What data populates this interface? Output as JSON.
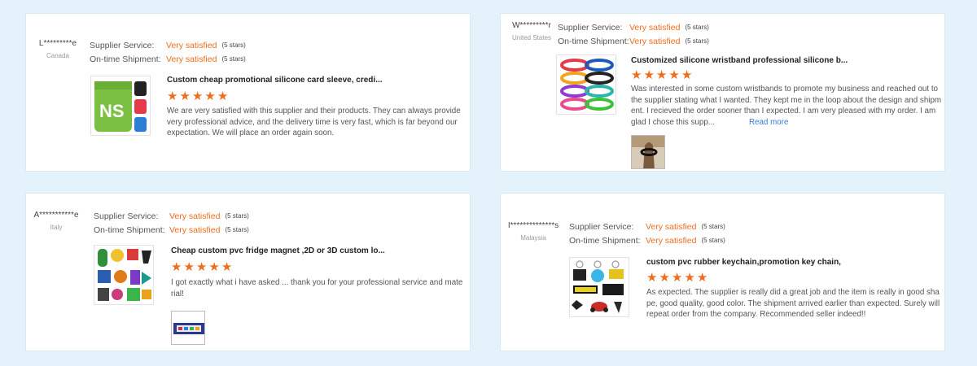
{
  "reviews": [
    {
      "buyer": "L*********e",
      "country": "Canada",
      "supplier_label": "Supplier Service:",
      "supplier_value": "Very satisfied",
      "supplier_stars": "(5 stars)",
      "shipment_label": "On-time Shipment:",
      "shipment_value": "Very satisfied",
      "shipment_stars": "(5 stars)",
      "product_title": "Custom cheap promotional silicone card sleeve, credi...",
      "rating": 5,
      "text": "We are very satisfied with this supplier and their products. They can always provide very professional advice, and the delivery time is very fast, which is far beyond our expectation. We will place an order again soon.",
      "image_icon": "silicone-card-sleeve-product-icon"
    },
    {
      "buyer": "W*********r",
      "country": "United States",
      "supplier_label": "Supplier Service:",
      "supplier_value": "Very satisfied",
      "supplier_stars": "(5 stars)",
      "shipment_label": "On-time Shipment:",
      "shipment_value": "Very satisfied",
      "shipment_stars": "(5 stars)",
      "product_title": "Customized silicone wristband professional silicone b...",
      "rating": 5,
      "text": "Was interested in some custom wristbands to promote my business and reached out to the supplier stating what I wanted. They kept me in the loop about the design and shipment. I recieved the order sooner than I expected. I am very pleased with my order. I am glad I chose this supp...",
      "read_more": "Read more",
      "image_icon": "silicone-wristband-product-icon",
      "buyer_photo_icon": "buyer-photo-wristband-icon"
    },
    {
      "buyer": "A***********e",
      "country": "Italy",
      "supplier_label": "Supplier Service:",
      "supplier_value": "Very satisfied",
      "supplier_stars": "(5 stars)",
      "shipment_label": "On-time Shipment:",
      "shipment_value": "Very satisfied",
      "shipment_stars": "(5 stars)",
      "product_title": "Cheap custom pvc fridge magnet ,2D or 3D custom lo...",
      "rating": 5,
      "text": "I got exactly what i have asked ... thank you for your professional service and material!",
      "image_icon": "pvc-fridge-magnet-product-icon",
      "buyer_photo_icon": "buyer-photo-magnet-icon"
    },
    {
      "buyer": "I**************s",
      "country": "Malaysia",
      "supplier_label": "Supplier Service:",
      "supplier_value": "Very satisfied",
      "supplier_stars": "(5 stars)",
      "shipment_label": "On-time Shipment:",
      "shipment_value": "Very satisfied",
      "shipment_stars": "(5 stars)",
      "product_title": "custom pvc rubber keychain,promotion key chain,",
      "rating": 5,
      "text": "As expected. The supplier is really did a great job and the item is really in good shape, good quality, good color. The shipment arrived earlier than expected. Surely will repeat order from the company. Recommended seller indeed!!",
      "image_icon": "pvc-keychain-product-icon"
    }
  ],
  "colors": {
    "page_background": "#e3f2fb",
    "accent": "#f06c1e",
    "link": "#3a7bd5"
  }
}
